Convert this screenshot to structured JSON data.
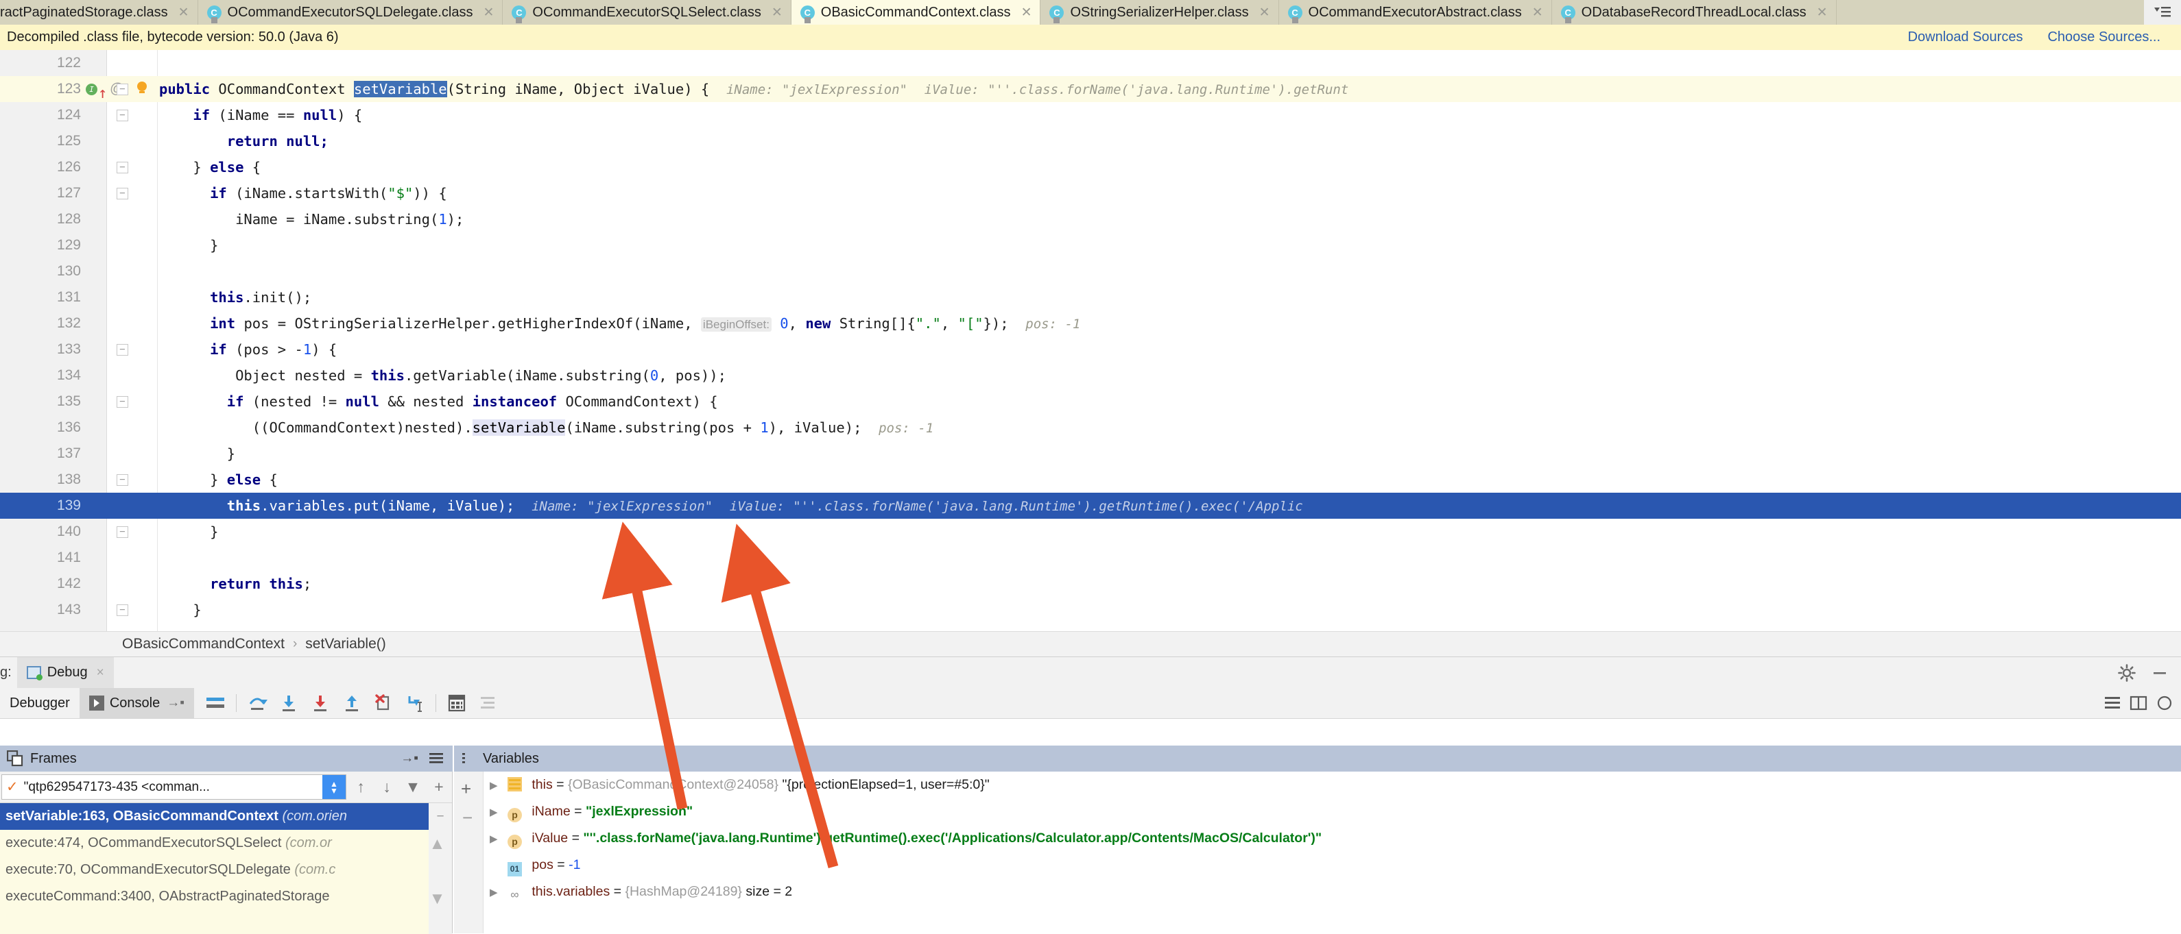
{
  "tabs": [
    {
      "label": "ractPaginatedStorage.class",
      "active": false,
      "truncated": true
    },
    {
      "label": "OCommandExecutorSQLDelegate.class",
      "active": false
    },
    {
      "label": "OCommandExecutorSQLSelect.class",
      "active": false
    },
    {
      "label": "OBasicCommandContext.class",
      "active": true
    },
    {
      "label": "OStringSerializerHelper.class",
      "active": false
    },
    {
      "label": "OCommandExecutorAbstract.class",
      "active": false
    },
    {
      "label": "ODatabaseRecordThreadLocal.class",
      "active": false
    }
  ],
  "tab_overflow_icon": "tab-list-icon",
  "notification": {
    "text": "Decompiled .class file, bytecode version: 50.0 (Java 6)",
    "download_sources": "Download Sources",
    "choose_sources": "Choose Sources..."
  },
  "editor": {
    "lines": [
      {
        "num": "122"
      },
      {
        "num": "123"
      },
      {
        "num": "124"
      },
      {
        "num": "125"
      },
      {
        "num": "126"
      },
      {
        "num": "127"
      },
      {
        "num": "128"
      },
      {
        "num": "129"
      },
      {
        "num": "130"
      },
      {
        "num": "131"
      },
      {
        "num": "132"
      },
      {
        "num": "133"
      },
      {
        "num": "134"
      },
      {
        "num": "135"
      },
      {
        "num": "136"
      },
      {
        "num": "137"
      },
      {
        "num": "138"
      },
      {
        "num": "139"
      },
      {
        "num": "140"
      },
      {
        "num": "141"
      },
      {
        "num": "142"
      },
      {
        "num": "143"
      }
    ],
    "line123_hint_iname_key": "iName:",
    "line123_hint_iname_val": "\"jexlExpression\"",
    "line123_hint_ivalue_key": "iValue:",
    "line123_hint_ivalue_val": "\"''.class.forName('java.lang.Runtime').getRunt",
    "line132_param_hint": "iBeginOffset:",
    "line132_pos_hint": "pos: -1",
    "line136_pos_hint": "pos: -1",
    "line139_hint_iname_key": "iName:",
    "line139_hint_iname_val": "\"jexlExpression\"",
    "line139_hint_ivalue_key": "iValue:",
    "line139_hint_ivalue_val": "\"''.class.forName('java.lang.Runtime').getRuntime().exec('/Applic",
    "highlighted_method": "setVariable"
  },
  "breadcrumb": {
    "class": "OBasicCommandContext",
    "separator": "›",
    "method": "setVariable()"
  },
  "debug_window": {
    "prefix": "g:",
    "tab_label": "Debug",
    "tab_close": "×",
    "settings_icon": "gear-icon",
    "minimize_icon": "minimize-icon"
  },
  "debugger_toolbar": {
    "tab_debugger": "Debugger",
    "tab_console": "Console",
    "console_pin_icon": "pin-icon",
    "buttons": [
      {
        "name": "show-execution-point-icon",
        "glyph": "≡"
      },
      {
        "name": "step-over-icon",
        "glyph": "⤴"
      },
      {
        "name": "step-into-icon",
        "glyph": "↓"
      },
      {
        "name": "force-step-into-icon",
        "glyph": "↓"
      },
      {
        "name": "step-out-icon",
        "glyph": "↑"
      },
      {
        "name": "drop-frame-icon",
        "glyph": "✖"
      },
      {
        "name": "run-to-cursor-icon",
        "glyph": "↘"
      },
      {
        "name": "evaluate-expression-icon",
        "glyph": "▦"
      },
      {
        "name": "settings-list-icon",
        "glyph": "≣"
      }
    ],
    "right_icons": [
      "layout-icon",
      "split-icon",
      "help-icon"
    ]
  },
  "frames_panel": {
    "title": "Frames",
    "pin_icon": "pin-icon",
    "menu_icon": "menu-icon",
    "thread": "\"qtp629547173-435 <comman...",
    "thread_check": "✓",
    "up_icon": "↑",
    "down_icon": "↓",
    "filter_icon": "▼",
    "add_icon": "+",
    "frames": [
      {
        "method": "setVariable:163, OBasicCommandContext",
        "pkg": "(com.orien",
        "active": true
      },
      {
        "method": "execute:474, OCommandExecutorSQLSelect",
        "pkg": "(com.or",
        "active": false
      },
      {
        "method": "execute:70, OCommandExecutorSQLDelegate",
        "pkg": "(com.c",
        "active": false
      },
      {
        "method": "executeCommand:3400, OAbstractPaginatedStorage",
        "pkg": "",
        "active": false
      }
    ],
    "scroll_minus": "−",
    "scroll_up": "▲",
    "scroll_down": "▼"
  },
  "variables_panel": {
    "title": "Variables",
    "list_icon": "list-icon",
    "add_icon": "+",
    "remove_icon": "−",
    "rows": [
      {
        "icon": "object-icon",
        "icon_glyph": "",
        "name": "this",
        "eq": " = ",
        "ref": "{OBasicCommandContext@24058}",
        "value": "\"{projectionElapsed=1, user=#5:0}\"",
        "value_kind": "plain",
        "expandable": true
      },
      {
        "icon": "param-icon",
        "icon_glyph": "p",
        "name": "iName",
        "eq": " = ",
        "ref": "",
        "value": "\"jexlExpression\"",
        "value_kind": "string",
        "expandable": true
      },
      {
        "icon": "param-icon",
        "icon_glyph": "p",
        "name": "iValue",
        "eq": " = ",
        "ref": "",
        "value": "\"''.class.forName('java.lang.Runtime').getRuntime().exec('/Applications/Calculator.app/Contents/MacOS/Calculator')\"",
        "value_kind": "string",
        "expandable": true
      },
      {
        "icon": "primitive-icon",
        "icon_glyph": "01",
        "name": "pos",
        "eq": " = ",
        "ref": "",
        "value": "-1",
        "value_kind": "number",
        "expandable": false
      },
      {
        "icon": "collection-icon",
        "icon_glyph": "∞",
        "name": "this.variables",
        "eq": " = ",
        "ref": "{HashMap@24189}",
        "value": "size = 2",
        "value_kind": "plain",
        "expandable": true
      }
    ]
  },
  "annotations": {
    "arrow_color": "#e8542a",
    "arrows": [
      {
        "name": "arrow-to-iname",
        "label": ""
      },
      {
        "name": "arrow-to-ivalue",
        "label": ""
      }
    ]
  },
  "colors": {
    "selection_blue": "#2a57b0",
    "tab_bg": "#d6d3bd",
    "active_tab_bg": "#fdfbe4",
    "notification_bg": "#fdf6c8",
    "link_blue": "#2a5db0",
    "string_green": "#067d17",
    "keyword_navy": "#000080",
    "panel_header": "#b8c4d8"
  }
}
